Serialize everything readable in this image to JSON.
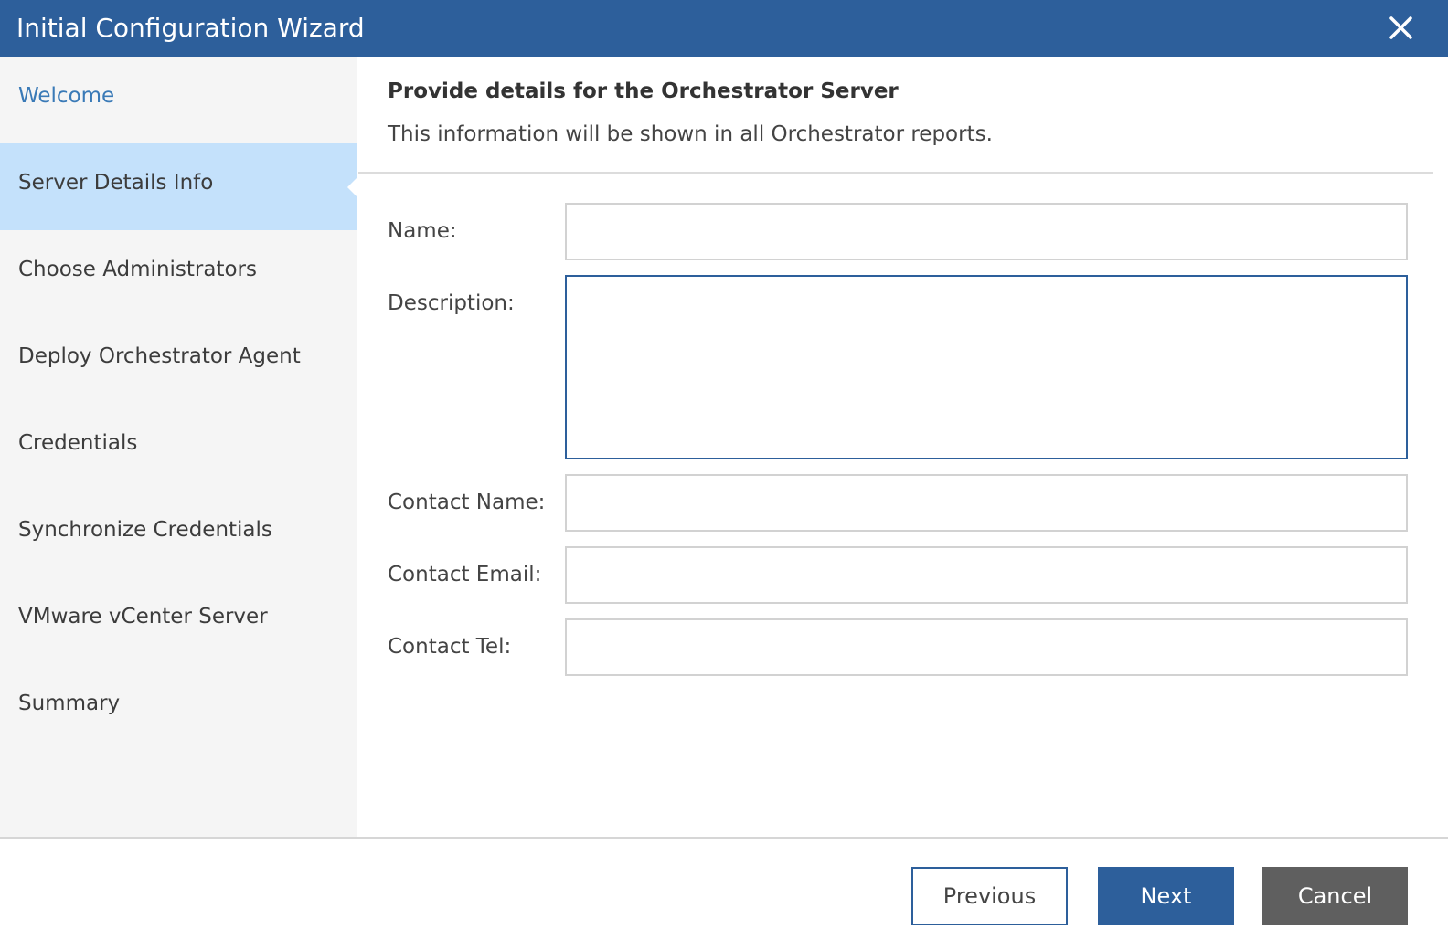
{
  "window": {
    "title": "Initial Configuration Wizard",
    "close_icon": "close-icon"
  },
  "sidebar": {
    "steps": [
      {
        "label": "Welcome",
        "state": "visited"
      },
      {
        "label": "Server Details Info",
        "state": "active"
      },
      {
        "label": "Choose Administrators",
        "state": "pending"
      },
      {
        "label": "Deploy Orchestrator Agent",
        "state": "pending"
      },
      {
        "label": "Credentials",
        "state": "pending"
      },
      {
        "label": "Synchronize Credentials",
        "state": "pending"
      },
      {
        "label": "VMware vCenter Server",
        "state": "pending"
      },
      {
        "label": "Summary",
        "state": "pending"
      }
    ]
  },
  "main": {
    "heading": "Provide details for the Orchestrator Server",
    "subheading": "This information will be shown in all Orchestrator reports.",
    "fields": {
      "name": {
        "label": "Name:",
        "value": ""
      },
      "description": {
        "label": "Description:",
        "value": ""
      },
      "contact_name": {
        "label": "Contact Name:",
        "value": ""
      },
      "contact_email": {
        "label": "Contact Email:",
        "value": ""
      },
      "contact_tel": {
        "label": "Contact Tel:",
        "value": ""
      }
    }
  },
  "footer": {
    "previous_label": "Previous",
    "next_label": "Next",
    "cancel_label": "Cancel"
  },
  "colors": {
    "brand": "#2d5f9b",
    "active_step": "#c4e1fb",
    "link": "#3a7ab7",
    "cancel": "#5f5f5f"
  }
}
